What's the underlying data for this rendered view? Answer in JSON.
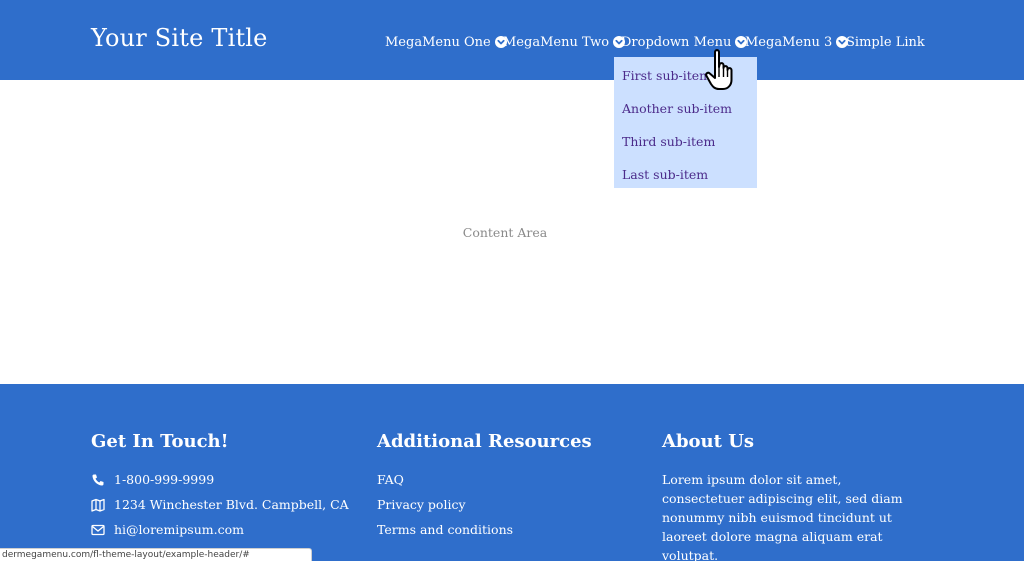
{
  "header": {
    "site_title": "Your Site Title",
    "nav": [
      {
        "label": "MegaMenu One",
        "has_dropdown": true
      },
      {
        "label": "MegaMenu Two",
        "has_dropdown": true
      },
      {
        "label": "Dropdown Menu",
        "has_dropdown": true
      },
      {
        "label": "MegaMenu 3",
        "has_dropdown": true
      },
      {
        "label": "Simple Link",
        "has_dropdown": false
      }
    ],
    "dropdown": {
      "items": [
        "First sub-item",
        "Another sub-item",
        "Third sub-item",
        "Last sub-item"
      ]
    }
  },
  "content": {
    "label": "Content Area"
  },
  "footer": {
    "contact": {
      "heading": "Get In Touch!",
      "phone": "1-800-999-9999",
      "address": "1234 Winchester Blvd. Campbell, CA",
      "email": "hi@loremipsum.com"
    },
    "resources": {
      "heading": "Additional Resources",
      "links": [
        "FAQ",
        "Privacy policy",
        "Terms and conditions"
      ]
    },
    "about": {
      "heading": "About Us",
      "text": "Lorem ipsum dolor sit amet, consectetuer adipiscing elit, sed diam nonummy nibh euismod tincidunt ut laoreet dolore magna aliquam erat volutpat."
    }
  },
  "statusbar": {
    "url": "dermegamenu.com/fl-theme-layout/example-header/#"
  },
  "colors": {
    "header_bg": "#2f6ecb",
    "dropdown_bg": "#cce0ff",
    "dropdown_text": "#4b2a8a",
    "text_on_blue": "#ffffff"
  }
}
